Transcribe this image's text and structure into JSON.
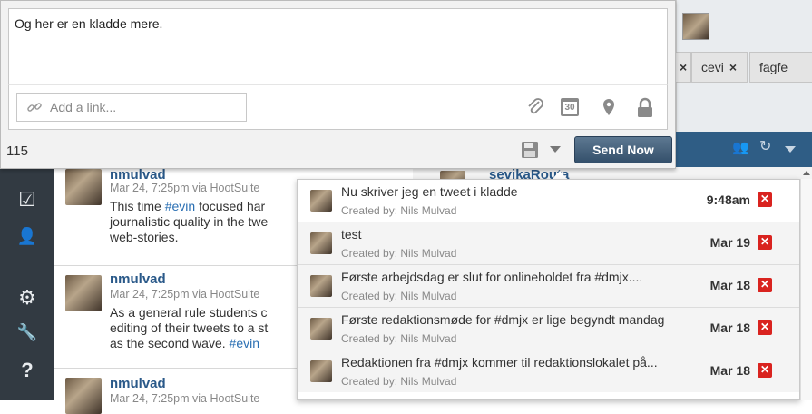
{
  "compose": {
    "text": "Og her er en kladde mere.",
    "link_placeholder": "Add a link...",
    "char_count": "115",
    "send_label": "Send Now"
  },
  "tabs": [
    {
      "label": "cevi"
    },
    {
      "label": "fagfe"
    }
  ],
  "tab_close": "×",
  "stream": {
    "tweets": [
      {
        "user": "nmulvad",
        "meta": "Mar 24, 7:25pm via HootSuite",
        "lines": [
          "This time ",
          "#evin",
          " focused har",
          "journalistic quality in the twe",
          "web-stories."
        ]
      },
      {
        "user": "nmulvad",
        "meta": "Mar 24, 7:25pm via HootSuite",
        "lines": [
          "As a general rule students c",
          "editing of their tweets to a st",
          "as the second wave. ",
          "#evin"
        ]
      },
      {
        "user": "nmulvad",
        "meta": "Mar 24, 7:25pm via HootSuite"
      }
    ]
  },
  "right_col_user": "sevikaRouta",
  "drafts": [
    {
      "title": "Nu skriver jeg en tweet i kladde",
      "by": "Created by: Nils Mulvad",
      "time": "9:48am"
    },
    {
      "title": "test",
      "by": "Created by: Nils Mulvad",
      "time": "Mar 19"
    },
    {
      "title": "Første arbejdsdag er slut for onlineholdet fra #dmjx....",
      "by": "Created by: Nils Mulvad",
      "time": "Mar 18"
    },
    {
      "title": "Første redaktionsmøde for #dmjx er lige begyndt mandag",
      "by": "Created by: Nils Mulvad",
      "time": "Mar 18"
    },
    {
      "title": "Redaktionen fra #dmjx kommer til redaktionslokalet på...",
      "by": "Created by: Nils Mulvad",
      "time": "Mar 18"
    }
  ],
  "draft_delete": "✕",
  "icons": {
    "link": "link-icon",
    "attach": "paperclip-icon",
    "schedule": "calendar-icon",
    "schedule_day": "30",
    "location": "location-pin-icon",
    "privacy": "lock-icon",
    "save_draft": "floppy-disk-icon",
    "sidebar": [
      "checkbox-icon",
      "person-icon",
      "gear-icon",
      "wrench-icon",
      "question-icon"
    ],
    "sidebar_glyphs": [
      "☑",
      "👤",
      "⚙",
      "🔧",
      "?"
    ]
  },
  "colors": {
    "send_button": "#3f5a75",
    "sidebar": "#323a42",
    "username": "#2a5989",
    "hashtag": "#2a6fb3",
    "delete": "#d9231f",
    "top_bar": "#2f5d85"
  }
}
